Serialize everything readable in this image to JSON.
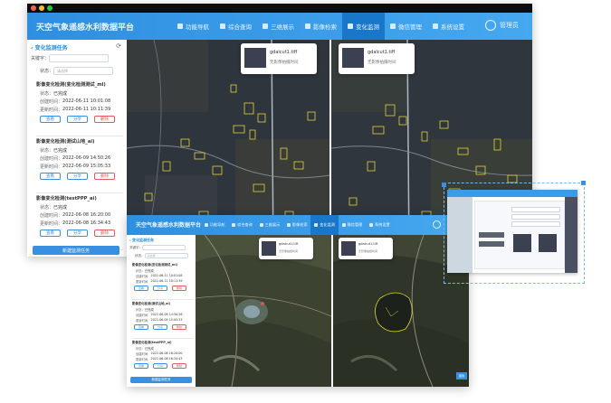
{
  "app": {
    "title": "天空气象遥感水利数据平台"
  },
  "nav": [
    {
      "label": "功能导航",
      "icon": "grid-icon",
      "active": false
    },
    {
      "label": "综合查询",
      "icon": "search-icon",
      "active": false
    },
    {
      "label": "三维展示",
      "icon": "cube-icon",
      "active": false
    },
    {
      "label": "影像检索",
      "icon": "image-icon",
      "active": false
    },
    {
      "label": "变化监测",
      "icon": "monitor-icon",
      "active": true
    },
    {
      "label": "微信管理",
      "icon": "chat-icon",
      "active": false
    },
    {
      "label": "系统设置",
      "icon": "gear-icon",
      "active": false
    }
  ],
  "user": {
    "label": "管理员"
  },
  "panel": {
    "title": "变化监测任务",
    "keyword_label": "关键字：",
    "status_label": "状态：",
    "status_placeholder": "请选择",
    "new_task_button": "新建监测任务",
    "field_labels": {
      "status": "状态：",
      "created": "创建时间：",
      "updated": "更新时间："
    },
    "actions": {
      "view": "查看",
      "share": "分享",
      "delete": "删除"
    },
    "tasks": [
      {
        "name": "影像变化检测(变化检测测试_ml)",
        "status": "已完成",
        "created": "2022-06-11 10:01:08",
        "updated": "2022-06-11 10:11:39"
      },
      {
        "name": "影像变化检测(测试山地_ai)",
        "status": "已完成",
        "created": "2022-06-09 14:50:26",
        "updated": "2022-06-09 15:05:33"
      },
      {
        "name": "影像变化检测(testPPP_ai)",
        "status": "已完成",
        "created": "2022-06-08 16:20:00",
        "updated": "2022-06-08 16:34:43"
      }
    ]
  },
  "popups": {
    "left": {
      "filename": "gdalcut1.tiff",
      "desc": "无影像拍摄时间"
    },
    "right": {
      "filename": "gdalcut1.tiff",
      "desc": "无影像拍摄时间"
    }
  },
  "small_tag": "图例",
  "colors": {
    "header": "#3a9be8",
    "active_nav": "#1877c9",
    "accent": "#3a90e0",
    "danger": "#e05b5b",
    "change_outline": "#e0d23a"
  }
}
